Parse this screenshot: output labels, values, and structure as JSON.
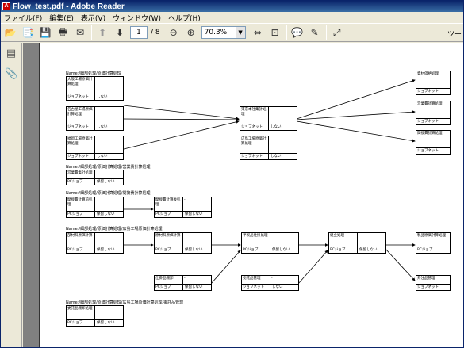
{
  "window": {
    "title": "Flow_test.pdf - Adobe Reader"
  },
  "menu": [
    "ファイル(F)",
    "編集(E)",
    "表示(V)",
    "ウィンドウ(W)",
    "ヘルプ(H)"
  ],
  "toolbar": {
    "page_current": "1",
    "page_total": "/ 8",
    "zoom": "70.3%",
    "tools": "ツー"
  },
  "doc": {
    "section1": "Name:/細部処理/原価計算処理",
    "section2": "Name:/細部処理/原価計算処理/営業費計算処理",
    "section3": "Name:/細部処理/原価計算処理/間接費計算処理",
    "section4": "Name:/細部処理/原価計算処理/広島工場原価計算処理",
    "section5": "Name:/細部処理/原価計算処理/広島工場原価計算処理/委託品管理"
  },
  "jobs": {
    "j1": {
      "name": "大阪工場原価計算処理",
      "dash": "",
      "type": "ジョブネット",
      "opt": "しない"
    },
    "j2": {
      "name": "名古屋工場原価計算処理",
      "dash": "",
      "type": "ジョブネット",
      "opt": "しない"
    },
    "j3": {
      "name": "福岡工場原価計算処理",
      "dash": "",
      "type": "ジョブネット",
      "opt": "しない"
    },
    "j4": {
      "name": "東京本社集計処理",
      "dash": "-",
      "type": "ジョブネット",
      "opt": "しない"
    },
    "j5": {
      "name": "広島工場原価計算処理",
      "dash": "",
      "type": "ジョブネット",
      "opt": "しない"
    },
    "j6": {
      "name": "資材価格処理",
      "dash": "",
      "type": "ジョブネット",
      "opt": ""
    },
    "j7": {
      "name": "営業費計算処理",
      "dash": "",
      "type": "ジョブネット",
      "opt": ""
    },
    "j8": {
      "name": "間接費計算処理",
      "dash": "",
      "type": "ジョブネット",
      "opt": ""
    },
    "j9": {
      "name": "営業費集計処理",
      "dash": "",
      "type": "PCジョブ",
      "opt": "保留しない"
    },
    "j10": {
      "name": "間接費計算前処理",
      "dash": "",
      "type": "PCジョブ",
      "opt": "保留しない"
    },
    "j11": {
      "name": "間接費計算後処理",
      "dash": "-",
      "type": "PCジョブ",
      "opt": "保留しない"
    },
    "j12": {
      "name": "部材料原価計算",
      "dash": "",
      "type": "PCジョブ",
      "opt": "保留しない"
    },
    "j13": {
      "name": "原材料原価計算",
      "dash": "-",
      "type": "PCジョブ",
      "opt": "保留しない"
    },
    "j14": {
      "name": "半製品仕掛処理",
      "dash": "-",
      "type": "PCジョブ",
      "opt": "保留しない"
    },
    "j15": {
      "name": "組立処理",
      "dash": "-",
      "type": "PCジョブ",
      "opt": "保留しない"
    },
    "j16": {
      "name": "製品原価計算処理",
      "dash": "",
      "type": "PCジョブ",
      "opt": ""
    },
    "j17": {
      "name": "仕掛品棚卸",
      "dash": "-",
      "type": "PCジョブ",
      "opt": "保留しない"
    },
    "j18": {
      "name": "委託品管理",
      "dash": "-",
      "type": "ジョブネット",
      "opt": "しない"
    },
    "j19": {
      "name": "外注品管理",
      "dash": "",
      "type": "ジョブネット",
      "opt": ""
    },
    "j20": {
      "name": "委託品棚卸処理",
      "dash": "",
      "type": "PCジョブ",
      "opt": "保留しない"
    }
  }
}
